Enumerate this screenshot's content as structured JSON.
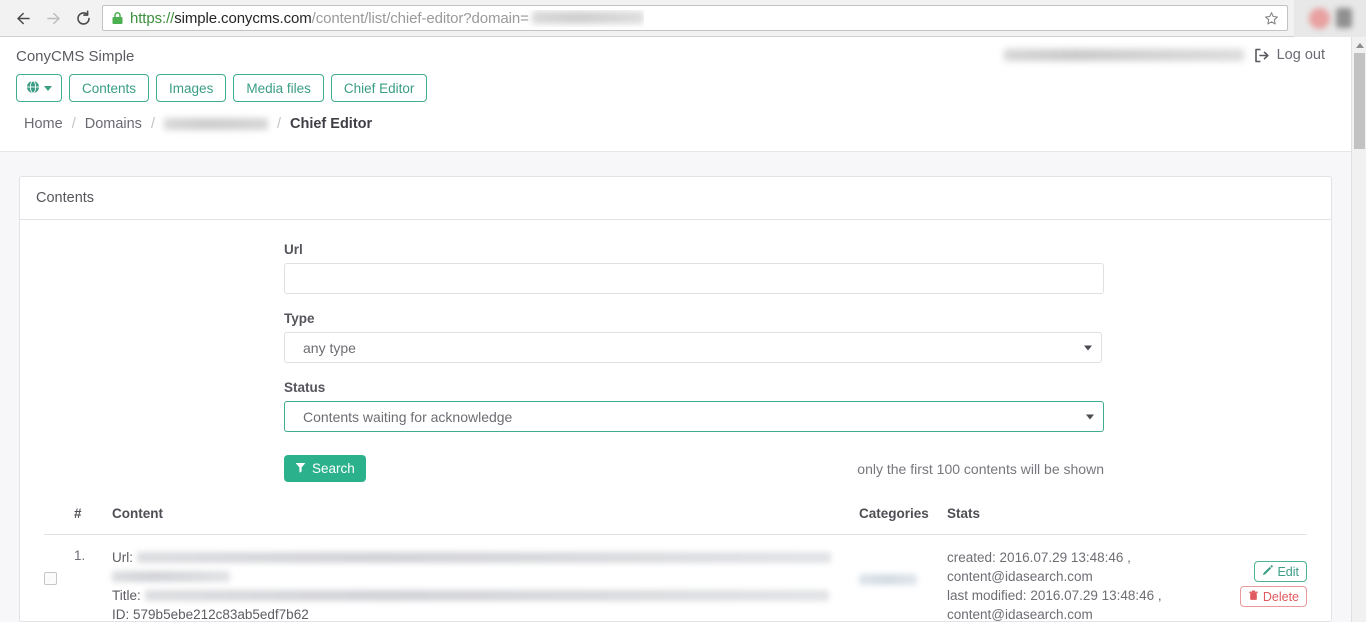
{
  "browser": {
    "back_icon": "back-arrow-icon",
    "forward_icon": "forward-arrow-icon",
    "reload_icon": "reload-icon",
    "lock_icon": "padlock-icon",
    "url_scheme": "https://",
    "url_host": "simple.conycms.com",
    "url_path": "/content/list/chief-editor?domain=",
    "url_redacted": true,
    "star_icon": "bookmark-star-icon"
  },
  "header": {
    "brand": "ConyCMS Simple",
    "user_redacted": true,
    "logout_label": "Log out",
    "logout_icon": "sign-out-icon",
    "nav": [
      {
        "label": "",
        "icon": "globe-icon",
        "caret": true,
        "name": "domain-selector"
      },
      {
        "label": "Contents",
        "icon": null,
        "caret": false,
        "name": "nav-contents"
      },
      {
        "label": "Images",
        "icon": null,
        "caret": false,
        "name": "nav-images"
      },
      {
        "label": "Media files",
        "icon": null,
        "caret": false,
        "name": "nav-media-files"
      },
      {
        "label": "Chief Editor",
        "icon": null,
        "caret": false,
        "name": "nav-chief-editor"
      }
    ],
    "breadcrumb": {
      "home": "Home",
      "domains": "Domains",
      "domain_redacted": true,
      "current": "Chief Editor",
      "separator": "/"
    }
  },
  "panel": {
    "title": "Contents"
  },
  "form": {
    "url": {
      "label": "Url",
      "value": "",
      "placeholder": ""
    },
    "type": {
      "label": "Type",
      "value": "any type"
    },
    "status": {
      "label": "Status",
      "value": "Contents waiting for acknowledge",
      "focused": true
    },
    "search_button": {
      "label": "Search",
      "icon": "filter-icon"
    },
    "hint": "only the first 100 contents will be shown"
  },
  "table": {
    "headers": {
      "num": "#",
      "content": "Content",
      "categories": "Categories",
      "stats": "Stats",
      "actions": ""
    },
    "rows": [
      {
        "index": "1.",
        "checked": false,
        "url_label": "Url:",
        "url_redacted": true,
        "title_label": "Title:",
        "title_redacted": true,
        "id_label": "ID:",
        "id_value": "579b5ebe212c83ab5edf7b62",
        "category_redacted": true,
        "stats": {
          "created_label": "created:",
          "created_value": "2016.07.29 13:48:46 ,",
          "created_author": "content@idasearch.com",
          "modified_label": "last modified:",
          "modified_value": "2016.07.29 13:48:46 ,",
          "modified_author": "content@idasearch.com"
        },
        "actions": {
          "edit": {
            "label": "Edit",
            "icon": "pencil-icon"
          },
          "delete": {
            "label": "Delete",
            "icon": "trash-icon"
          }
        }
      }
    ]
  },
  "colors": {
    "accent_teal": "#2bb28c",
    "accent_border": "#3fae90",
    "danger_red": "#e05a60",
    "page_bg": "#f7f7f9"
  }
}
